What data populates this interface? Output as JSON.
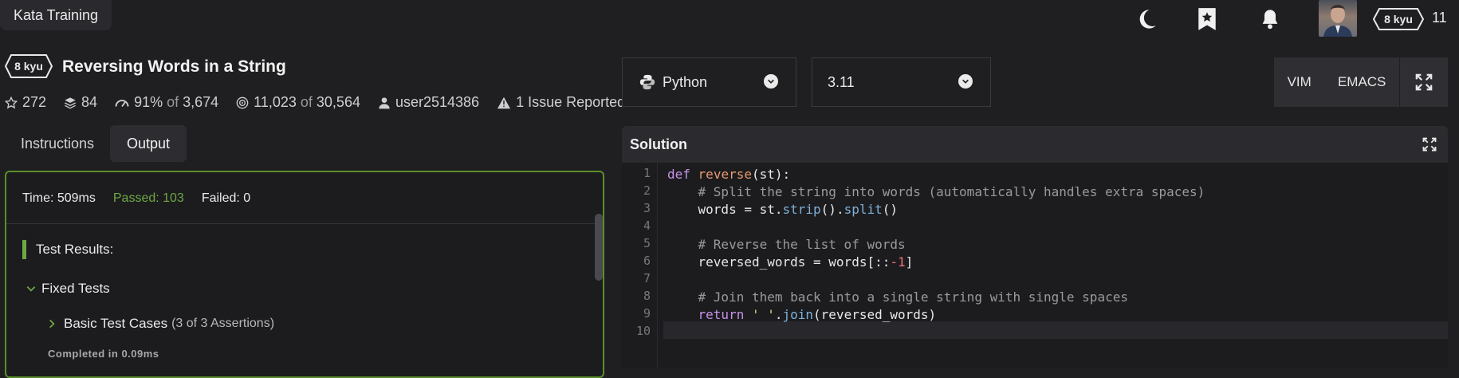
{
  "topbar": {
    "kata_training": "Kata Training",
    "rank_label": "8 kyu",
    "honor": "11"
  },
  "kata": {
    "rank": "8 kyu",
    "title": "Reversing Words in a String",
    "stats": {
      "stars": "272",
      "collections": "84",
      "satisfaction": "91%",
      "of": "of",
      "votes": "3,674",
      "completed": "11,023",
      "attempts": "30,564",
      "author": "user2514386",
      "issues": "1 Issue Reported"
    }
  },
  "tabs": {
    "instructions": "Instructions",
    "output": "Output"
  },
  "output": {
    "time": "Time: 509ms",
    "passed": "Passed: 103",
    "failed": "Failed: 0",
    "results_title": "Test Results:",
    "fixed_tests": "Fixed Tests",
    "basic_cases": "Basic Test Cases",
    "basic_cases_sub": "(3 of 3 Assertions)",
    "completed": "Completed in 0.09ms"
  },
  "editor": {
    "language": "Python",
    "version": "3.11",
    "vim": "VIM",
    "emacs": "EMACS",
    "solution_title": "Solution",
    "line_numbers": [
      "1",
      "2",
      "3",
      "4",
      "5",
      "6",
      "7",
      "8",
      "9",
      "10"
    ]
  },
  "code": {
    "l1_kw": "def",
    "l1_fn": "reverse",
    "l1_rest": "(st):",
    "l2": "    # Split the string into words (automatically handles extra spaces)",
    "l3_a": "    words = st.",
    "l3_m1": "strip",
    "l3_b": "().",
    "l3_m2": "split",
    "l3_c": "()",
    "l5": "    # Reverse the list of words",
    "l6_a": "    reversed_words = words[::",
    "l6_num": "-1",
    "l6_b": "]",
    "l8": "    # Join them back into a single string with single spaces",
    "l9_kw": "    return",
    "l9_str": " ' '",
    "l9_a": ".",
    "l9_m": "join",
    "l9_b": "(reversed_words)"
  },
  "colors": {
    "accent_green": "#6ea843",
    "panel_border": "#5b8d2b"
  }
}
